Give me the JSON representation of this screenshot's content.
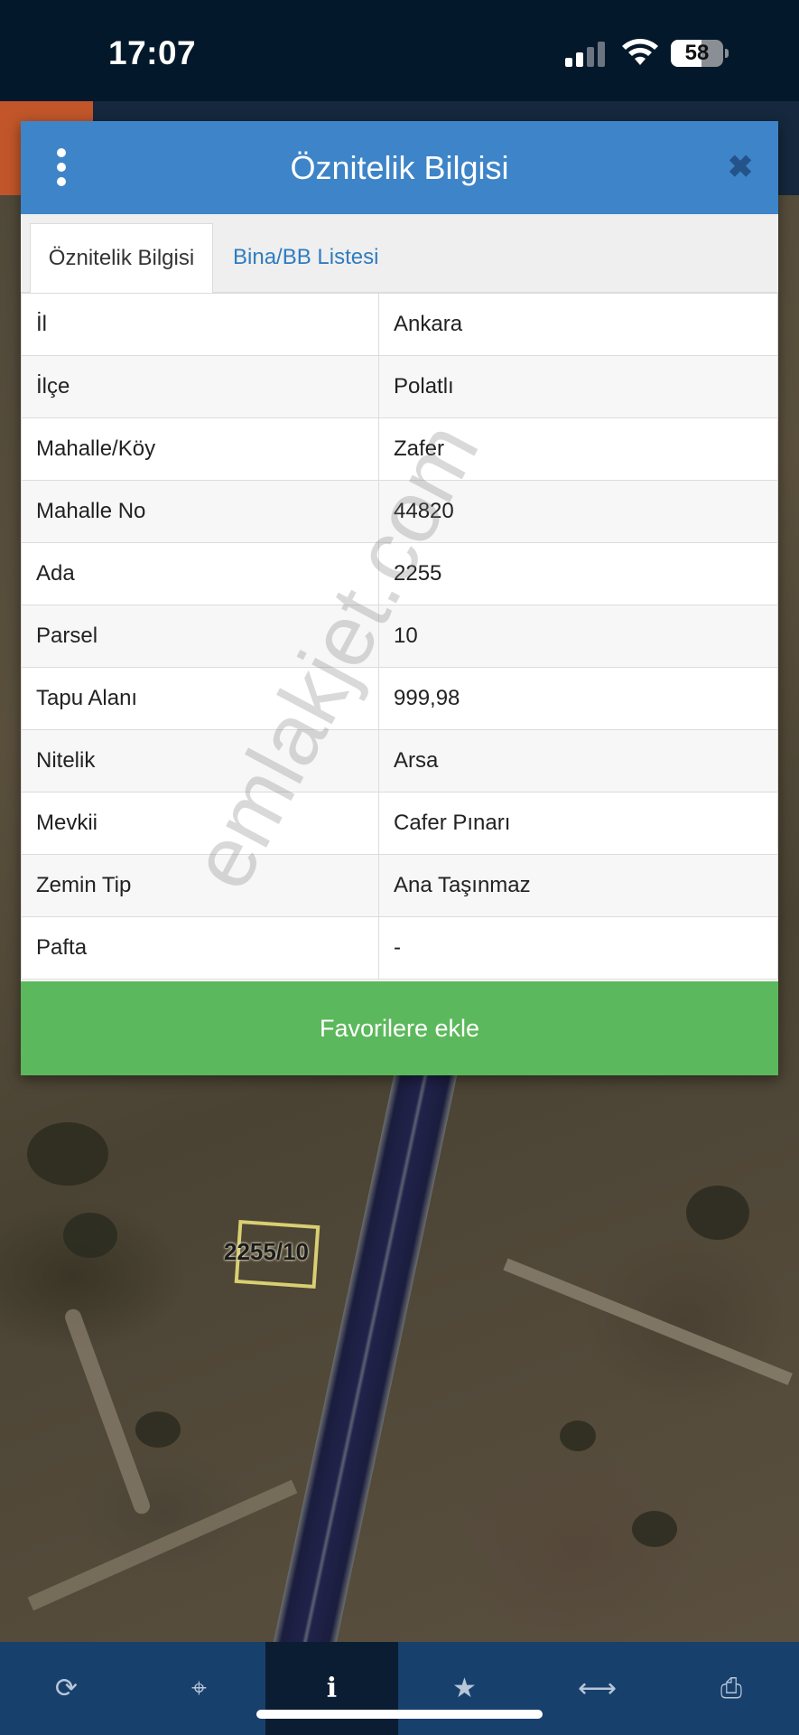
{
  "status_bar": {
    "time": "17:07",
    "battery_level": "58",
    "battery_fraction": 0.58
  },
  "modal": {
    "title": "Öznitelik Bilgisi",
    "close_glyph": "✖",
    "tabs": [
      {
        "label": "Öznitelik Bilgisi",
        "active": true
      },
      {
        "label": "Bina/BB Listesi",
        "active": false
      }
    ],
    "rows": [
      {
        "key": "İl",
        "value": "Ankara"
      },
      {
        "key": "İlçe",
        "value": "Polatlı"
      },
      {
        "key": "Mahalle/Köy",
        "value": "Zafer"
      },
      {
        "key": "Mahalle No",
        "value": "44820"
      },
      {
        "key": "Ada",
        "value": "2255"
      },
      {
        "key": "Parsel",
        "value": "10"
      },
      {
        "key": "Tapu Alanı",
        "value": "999,98"
      },
      {
        "key": "Nitelik",
        "value": "Arsa"
      },
      {
        "key": "Mevkii",
        "value": "Cafer Pınarı"
      },
      {
        "key": "Zemin Tip",
        "value": "Ana Taşınmaz"
      },
      {
        "key": "Pafta",
        "value": "-"
      }
    ],
    "favorite_button": "Favorilere ekle"
  },
  "map": {
    "parcel_label": "2255/10"
  },
  "watermark": "emlakjet.com",
  "toolbar": {
    "items": [
      {
        "icon": "refresh-icon",
        "glyph": "⟳",
        "active": false
      },
      {
        "icon": "locate-icon",
        "glyph": "⌖",
        "active": false
      },
      {
        "icon": "info-icon",
        "glyph": "i",
        "active": true
      },
      {
        "icon": "star-icon",
        "glyph": "★",
        "active": false
      },
      {
        "icon": "measure-icon",
        "glyph": "⟷",
        "active": false
      },
      {
        "icon": "print-icon",
        "glyph": "⎙",
        "active": false
      }
    ]
  },
  "colors": {
    "header": "#3e84c8",
    "favorite": "#5cb85c",
    "tab_link": "#2f7cc0",
    "toolbar": "#18406c"
  }
}
